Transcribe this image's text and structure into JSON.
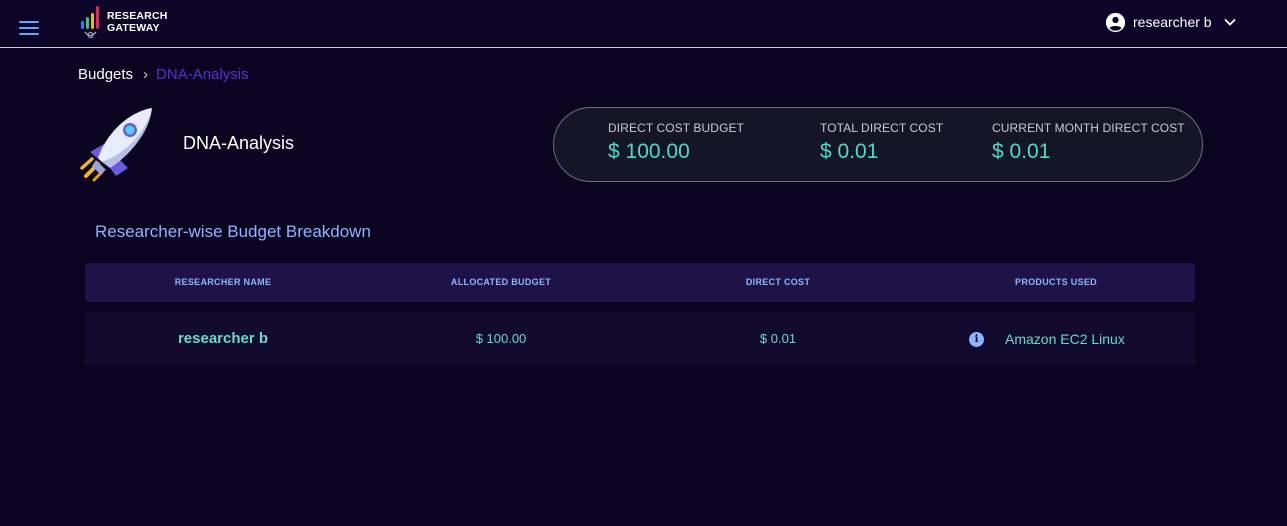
{
  "app": {
    "logo_line1": "RESEARCH",
    "logo_line2": "GATEWAY",
    "user_name": "researcher b",
    "icons": {
      "menu": "hamburger-menu-icon",
      "account": "account-circle-icon",
      "dropdown": "chevron-down-icon",
      "info": "info-icon",
      "project": "rocket-icon"
    },
    "colors": {
      "accent": "#3fe0c8",
      "heading": "#8cb5ff",
      "breadcrumb_current": "#5b2fd8",
      "background": "#0a0420"
    }
  },
  "breadcrumb": {
    "root": "Budgets",
    "separator": "›",
    "current": "DNA-Analysis"
  },
  "project": {
    "name": "DNA-Analysis"
  },
  "costs": {
    "direct_budget_label": "DIRECT COST BUDGET",
    "direct_budget_value": "$ 100.00",
    "total_direct_label": "TOTAL DIRECT COST",
    "total_direct_value": "$ 0.01",
    "month_direct_label": "CURRENT MONTH DIRECT COST",
    "month_direct_value": "$ 0.01"
  },
  "breakdown": {
    "title": "Researcher-wise Budget Breakdown",
    "columns": [
      "RESEARCHER NAME",
      "ALLOCATED BUDGET",
      "DIRECT COST",
      "PRODUCTS USED"
    ],
    "rows": [
      {
        "researcher": "researcher b",
        "allocated": "$ 100.00",
        "direct_cost": "$ 0.01",
        "product": "Amazon EC2 Linux"
      }
    ]
  }
}
